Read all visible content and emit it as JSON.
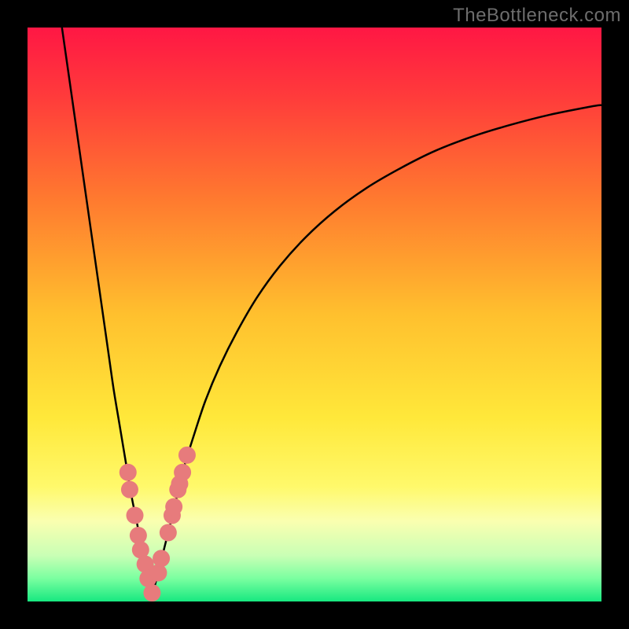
{
  "watermark": "TheBottleneck.com",
  "chart_data": {
    "type": "line",
    "title": "",
    "xlabel": "",
    "ylabel": "",
    "xlim": [
      0,
      100
    ],
    "ylim": [
      0,
      100
    ],
    "grid": false,
    "legend": false,
    "gradient_stops": [
      {
        "offset": 0.0,
        "color": "#ff1744"
      },
      {
        "offset": 0.12,
        "color": "#ff3b3b"
      },
      {
        "offset": 0.3,
        "color": "#ff7a2f"
      },
      {
        "offset": 0.5,
        "color": "#ffc02e"
      },
      {
        "offset": 0.68,
        "color": "#ffe83a"
      },
      {
        "offset": 0.8,
        "color": "#fff96b"
      },
      {
        "offset": 0.86,
        "color": "#faffb0"
      },
      {
        "offset": 0.92,
        "color": "#c9ffb5"
      },
      {
        "offset": 0.96,
        "color": "#7affa0"
      },
      {
        "offset": 1.0,
        "color": "#17e880"
      }
    ],
    "series": [
      {
        "name": "left-curve",
        "x": [
          6.0,
          7.0,
          8.0,
          9.0,
          10.0,
          11.0,
          12.0,
          13.0,
          14.0,
          15.0,
          16.0,
          17.0,
          18.0,
          19.0,
          20.0,
          21.0,
          21.7
        ],
        "y": [
          100.0,
          93.0,
          86.0,
          79.0,
          72.0,
          65.0,
          58.0,
          51.0,
          44.0,
          37.0,
          31.0,
          25.0,
          19.0,
          14.0,
          9.0,
          4.5,
          1.0
        ]
      },
      {
        "name": "right-curve",
        "x": [
          21.7,
          22.5,
          24.0,
          25.5,
          27.0,
          29.0,
          31.0,
          33.5,
          36.5,
          40.0,
          44.0,
          48.5,
          53.5,
          59.0,
          65.0,
          71.0,
          77.5,
          84.0,
          91.0,
          98.0,
          100.0
        ],
        "y": [
          1.0,
          4.0,
          10.0,
          16.0,
          22.5,
          29.0,
          35.0,
          41.0,
          47.0,
          53.0,
          58.5,
          63.5,
          68.0,
          72.0,
          75.5,
          78.5,
          81.0,
          83.0,
          84.8,
          86.2,
          86.5
        ]
      }
    ],
    "points": {
      "name": "highlight-points",
      "color": "#e77b7c",
      "radius": 11,
      "x": [
        17.5,
        17.8,
        18.7,
        19.3,
        19.7,
        20.5,
        21.0,
        21.7,
        22.8,
        23.3,
        24.5,
        25.2,
        25.5,
        26.2,
        26.5,
        27.0,
        27.8
      ],
      "y": [
        22.5,
        19.5,
        15.0,
        11.5,
        9.0,
        6.5,
        4.0,
        1.5,
        5.0,
        7.5,
        12.0,
        15.0,
        16.5,
        19.5,
        20.5,
        22.5,
        25.5
      ]
    }
  }
}
